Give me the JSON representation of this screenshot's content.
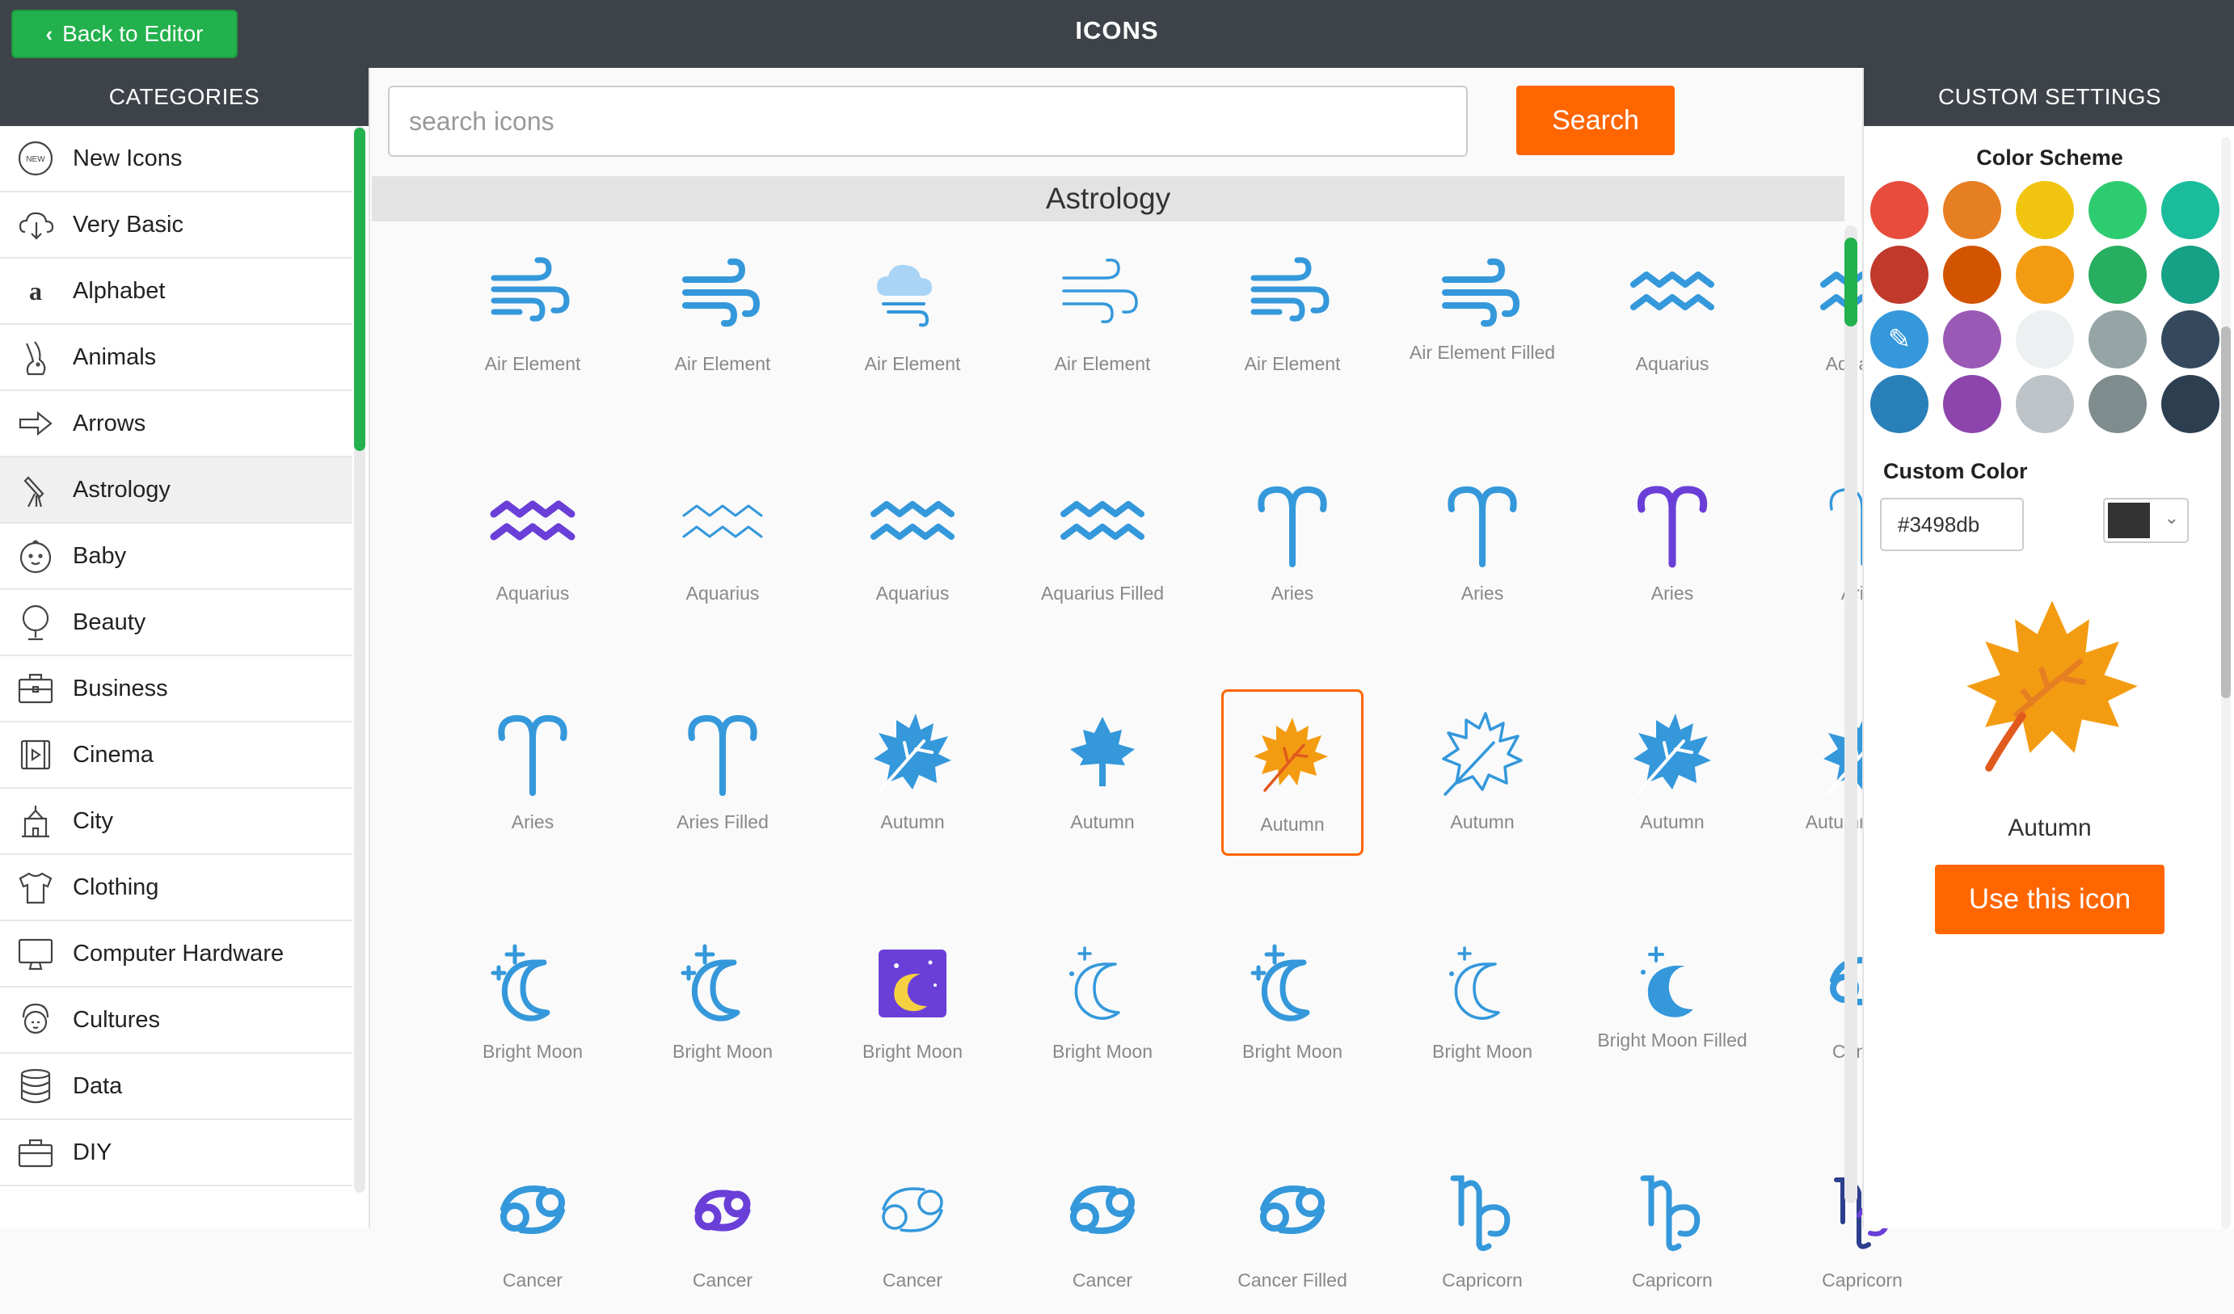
{
  "header": {
    "back_label": "Back to Editor",
    "title": "ICONS"
  },
  "categories": {
    "heading": "CATEGORIES",
    "items": [
      {
        "label": "New Icons",
        "icon": "new-badge-icon"
      },
      {
        "label": "Very Basic",
        "icon": "cloud-download-icon"
      },
      {
        "label": "Alphabet",
        "icon": "letter-a-icon"
      },
      {
        "label": "Animals",
        "icon": "rabbit-icon"
      },
      {
        "label": "Arrows",
        "icon": "right-arrow-icon"
      },
      {
        "label": "Astrology",
        "icon": "telescope-icon"
      },
      {
        "label": "Baby",
        "icon": "baby-face-icon"
      },
      {
        "label": "Beauty",
        "icon": "mirror-icon"
      },
      {
        "label": "Business",
        "icon": "briefcase-icon"
      },
      {
        "label": "Cinema",
        "icon": "film-icon"
      },
      {
        "label": "City",
        "icon": "city-building-icon"
      },
      {
        "label": "Clothing",
        "icon": "tshirt-icon"
      },
      {
        "label": "Computer Hardware",
        "icon": "monitor-icon"
      },
      {
        "label": "Cultures",
        "icon": "geisha-icon"
      },
      {
        "label": "Data",
        "icon": "database-icon"
      },
      {
        "label": "DIY",
        "icon": "toolbox-icon"
      }
    ],
    "active": "Astrology"
  },
  "search": {
    "placeholder": "search icons",
    "value": "",
    "button_label": "Search"
  },
  "section": {
    "title": "Astrology"
  },
  "icons": [
    {
      "label": "Air Element",
      "kind": "wind"
    },
    {
      "label": "Air Element",
      "kind": "wind2"
    },
    {
      "label": "Air Element",
      "kind": "cloudwind"
    },
    {
      "label": "Air Element",
      "kind": "windthin"
    },
    {
      "label": "Air Element",
      "kind": "wind"
    },
    {
      "label": "Air Element Filled",
      "kind": "wind2"
    },
    {
      "label": "Aquarius",
      "kind": "aquarius"
    },
    {
      "label": "Aquarius",
      "kind": "aquarius"
    },
    {
      "label": "Aquarius",
      "kind": "aquarius-purple"
    },
    {
      "label": "Aquarius",
      "kind": "aquarius-thin"
    },
    {
      "label": "Aquarius",
      "kind": "aquarius"
    },
    {
      "label": "Aquarius Filled",
      "kind": "aquarius"
    },
    {
      "label": "Aries",
      "kind": "aries"
    },
    {
      "label": "Aries",
      "kind": "aries"
    },
    {
      "label": "Aries",
      "kind": "aries-purple"
    },
    {
      "label": "Aries",
      "kind": "aries-thin"
    },
    {
      "label": "Aries",
      "kind": "aries"
    },
    {
      "label": "Aries Filled",
      "kind": "aries"
    },
    {
      "label": "Autumn",
      "kind": "leaf"
    },
    {
      "label": "Autumn",
      "kind": "maple"
    },
    {
      "label": "Autumn",
      "kind": "leaf-orange",
      "selected": true
    },
    {
      "label": "Autumn",
      "kind": "leaf-outline"
    },
    {
      "label": "Autumn",
      "kind": "leaf"
    },
    {
      "label": "Autumn Filled",
      "kind": "leaf"
    },
    {
      "label": "Bright Moon",
      "kind": "moon"
    },
    {
      "label": "Bright Moon",
      "kind": "moon"
    },
    {
      "label": "Bright Moon",
      "kind": "moon-box"
    },
    {
      "label": "Bright Moon",
      "kind": "moon-thin"
    },
    {
      "label": "Bright Moon",
      "kind": "moon"
    },
    {
      "label": "Bright Moon",
      "kind": "moon-thin"
    },
    {
      "label": "Bright Moon Filled",
      "kind": "moon-filled"
    },
    {
      "label": "Cancer",
      "kind": "cancer"
    },
    {
      "label": "Cancer",
      "kind": "cancer"
    },
    {
      "label": "Cancer",
      "kind": "cancer-purple"
    },
    {
      "label": "Cancer",
      "kind": "cancer-thin"
    },
    {
      "label": "Cancer",
      "kind": "cancer"
    },
    {
      "label": "Cancer Filled",
      "kind": "cancer"
    },
    {
      "label": "Capricorn",
      "kind": "capricorn"
    },
    {
      "label": "Capricorn",
      "kind": "capricorn"
    },
    {
      "label": "Capricorn",
      "kind": "capricorn-purple"
    }
  ],
  "settings": {
    "heading": "CUSTOM SETTINGS",
    "color_scheme_label": "Color Scheme",
    "swatches": [
      "#e74c3c",
      "#e67e22",
      "#f1c40f",
      "#2ecc71",
      "#1abc9c",
      "#c0392b",
      "#d35400",
      "#f39c12",
      "#27ae60",
      "#16a085",
      "#3498db",
      "#9b59b6",
      "#ecf0f1",
      "#95a5a6",
      "#34495e",
      "#2980b9",
      "#8e44ad",
      "#bdc3c7",
      "#7f8c8d",
      "#2c3e50"
    ],
    "selected_swatch": "#3498db",
    "custom_color_label": "Custom Color",
    "custom_color_value": "#3498db",
    "picker_color": "#333333",
    "preview_name": "Autumn",
    "use_button_label": "Use this icon"
  },
  "colors": {
    "accent_blue": "#3498db",
    "accent_orange": "#ff6600",
    "accent_purple": "#6a3fd8",
    "header_bg": "#3d4349",
    "green": "#22b14c"
  }
}
